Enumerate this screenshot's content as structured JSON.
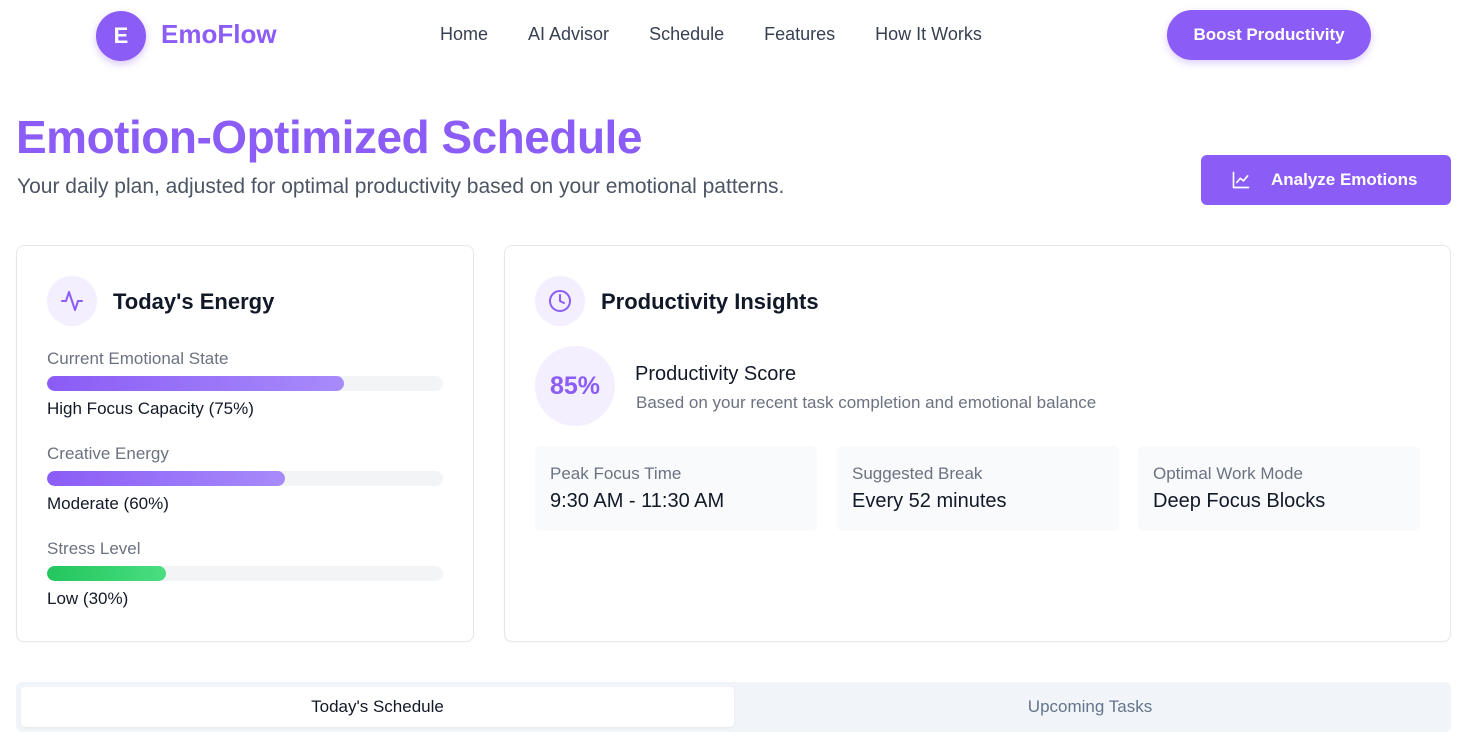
{
  "brand": {
    "initial": "E",
    "name": "EmoFlow",
    "accent": "#8b5cf6"
  },
  "nav": {
    "links": [
      "Home",
      "AI Advisor",
      "Schedule",
      "Features",
      "How It Works"
    ],
    "cta": "Boost Productivity"
  },
  "header": {
    "title": "Emotion-Optimized Schedule",
    "subtitle": "Your daily plan, adjusted for optimal productivity based on your emotional patterns.",
    "analyze_button": "Analyze Emotions",
    "analyze_icon": "line-chart-icon"
  },
  "energy": {
    "title": "Today's Energy",
    "icon": "activity-icon",
    "metrics": [
      {
        "label": "Current Emotional State",
        "value": "High Focus Capacity (75%)",
        "percent": 75,
        "color": "#8b5cf6"
      },
      {
        "label": "Creative Energy",
        "value": "Moderate (60%)",
        "percent": 60,
        "color": "#8b5cf6"
      },
      {
        "label": "Stress Level",
        "value": "Low (30%)",
        "percent": 30,
        "color": "#22c55e"
      }
    ]
  },
  "insights": {
    "title": "Productivity Insights",
    "icon": "clock-icon",
    "score": "85%",
    "score_title": "Productivity Score",
    "score_desc": "Based on your recent task completion and emotional balance",
    "stats": [
      {
        "label": "Peak Focus Time",
        "value": "9:30 AM - 11:30 AM"
      },
      {
        "label": "Suggested Break",
        "value": "Every 52 minutes"
      },
      {
        "label": "Optimal Work Mode",
        "value": "Deep Focus Blocks"
      }
    ]
  },
  "tabs": [
    {
      "label": "Today's Schedule",
      "active": true
    },
    {
      "label": "Upcoming Tasks",
      "active": false
    }
  ]
}
